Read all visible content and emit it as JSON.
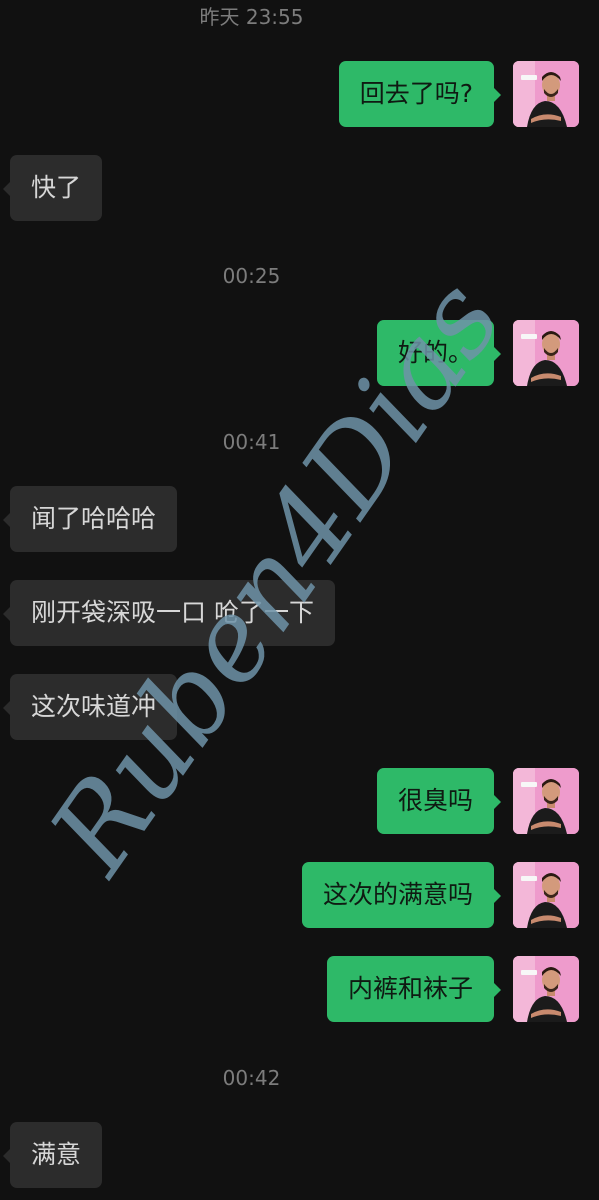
{
  "messages": [
    {
      "kind": "time",
      "text": "昨天 23:55"
    },
    {
      "kind": "out",
      "text": "回去了吗?"
    },
    {
      "kind": "in",
      "text": "快了"
    },
    {
      "kind": "time",
      "text": "00:25"
    },
    {
      "kind": "out",
      "text": "好的。"
    },
    {
      "kind": "time",
      "text": "00:41"
    },
    {
      "kind": "in",
      "text": "闻了哈哈哈"
    },
    {
      "kind": "in",
      "text": "刚开袋深吸一口 呛了一下"
    },
    {
      "kind": "in",
      "text": "这次味道冲"
    },
    {
      "kind": "out",
      "text": "很臭吗"
    },
    {
      "kind": "out",
      "text": "这次的满意吗"
    },
    {
      "kind": "out",
      "text": "内裤和袜子"
    },
    {
      "kind": "time",
      "text": "00:42"
    },
    {
      "kind": "in",
      "text": "满意"
    }
  ],
  "watermark": "Ruben4Dias",
  "colors": {
    "background": "#111111",
    "incoming_bubble": "#2c2c2c",
    "outgoing_bubble": "#2eb968",
    "timestamp": "#7c7c7c",
    "avatar_bg": "#ee9bcc",
    "watermark": "#6f93a8"
  }
}
